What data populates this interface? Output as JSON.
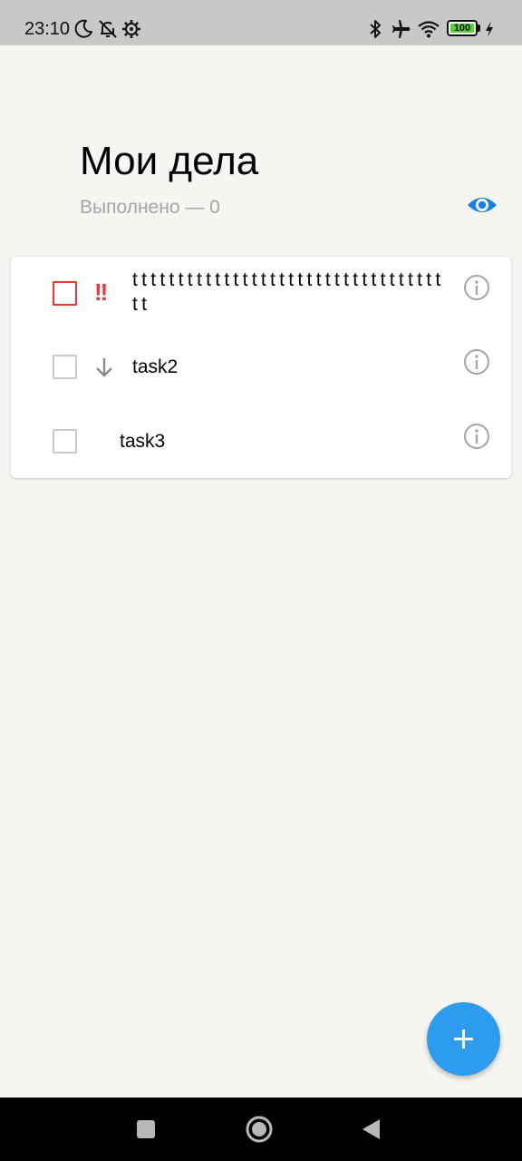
{
  "status_bar": {
    "time": "23:10",
    "battery_level": "100",
    "battery_fraction": 1.0,
    "icons": [
      "moon-icon",
      "notifications-off-icon",
      "settings-icon",
      "bluetooth-icon",
      "airplane-mode-icon",
      "wifi-icon",
      "battery-icon",
      "charging-icon"
    ]
  },
  "header": {
    "title": "Мои дела",
    "done_label": "Выполнено — 0",
    "visibility_icon": "eye-icon"
  },
  "tasks": [
    {
      "text": "tttttttttttttttttttttttttttttttttttt",
      "priority": "high",
      "priority_label": "!!",
      "done": false
    },
    {
      "text": "task2",
      "priority": "low",
      "priority_icon": "arrow-down-icon",
      "done": false
    },
    {
      "text": "task3",
      "priority": "none",
      "done": false
    }
  ],
  "fab": {
    "icon": "plus-icon"
  },
  "nav_bar": {
    "buttons": [
      "recents-icon",
      "home-icon",
      "back-icon"
    ]
  },
  "colors": {
    "accent": "#2d9cef",
    "high_priority": "#e53935",
    "background": "#f6f5f1",
    "secondary_text": "#a5a5a5"
  }
}
